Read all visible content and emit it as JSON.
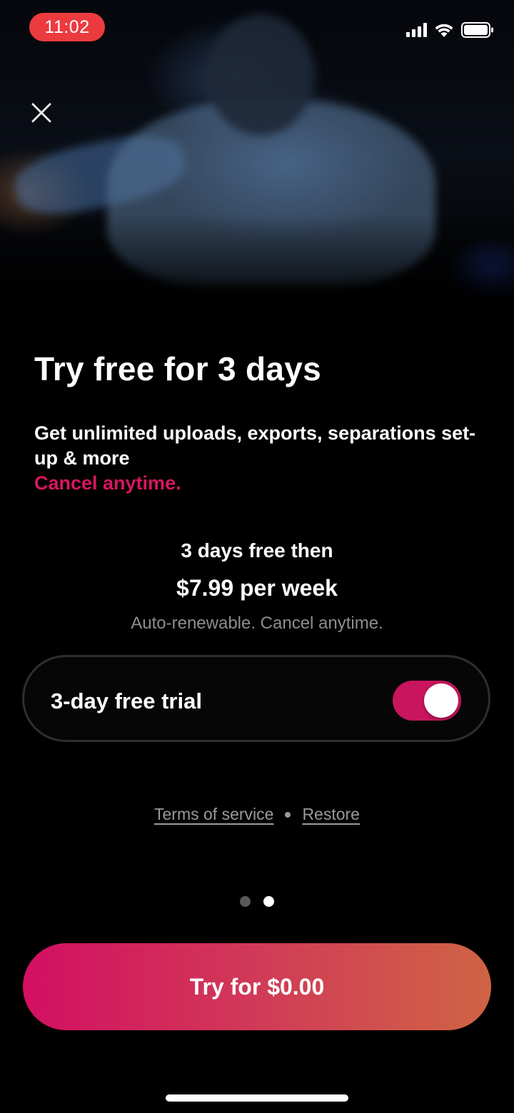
{
  "status_bar": {
    "time": "11:02",
    "icons": [
      "cellular-signal-icon",
      "wifi-icon",
      "battery-icon"
    ]
  },
  "colors": {
    "accent": "#d8165f",
    "toggle_on": "#c8155e",
    "cta_gradient_start": "#d30f62",
    "cta_gradient_end": "#cf6444",
    "time_pill": "#ec3b3f",
    "muted_text": "#8d8d8f"
  },
  "paywall": {
    "title": "Try free for 3 days",
    "subtitle": "Get unlimited uploads, exports, separations set-up & more",
    "cancel_text": "Cancel anytime.",
    "offer_line1": "3 days free then",
    "offer_line2": "$7.99 per week",
    "offer_note": "Auto-renewable. Cancel anytime.",
    "trial_toggle": {
      "label": "3-day free trial",
      "on": true
    },
    "links": {
      "terms": "Terms of service",
      "restore": "Restore"
    },
    "pager": {
      "count": 2,
      "active_index": 1
    },
    "cta_label": "Try for $0.00"
  }
}
